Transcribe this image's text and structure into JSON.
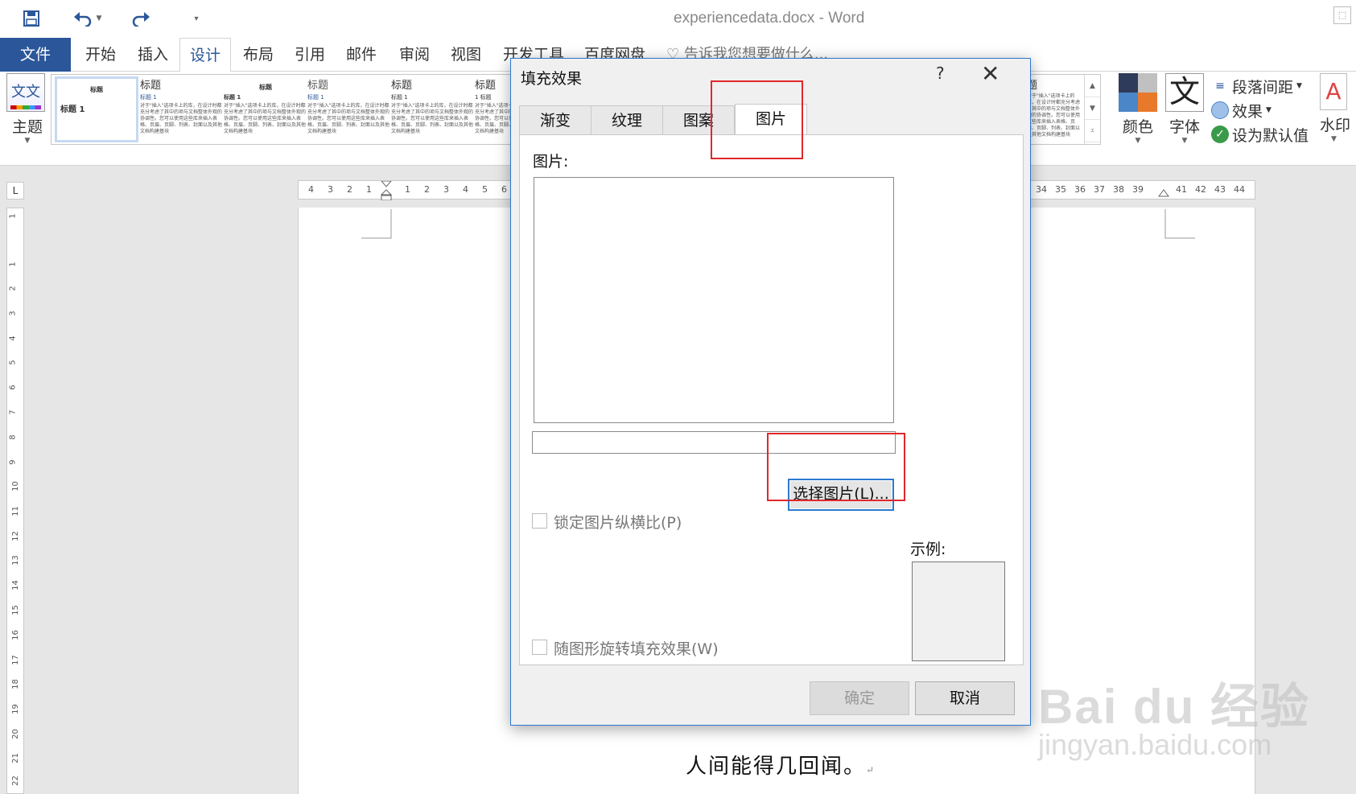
{
  "window": {
    "title": "experiencedata.docx - Word"
  },
  "qat": {
    "save_icon": "save-icon",
    "undo_icon": "undo-icon",
    "redo_icon": "redo-icon",
    "customize_icon": "customize-icon"
  },
  "tabs": [
    "文件",
    "开始",
    "插入",
    "设计",
    "布局",
    "引用",
    "邮件",
    "审阅",
    "视图",
    "开发工具",
    "百度网盘"
  ],
  "tell_me": "告诉我您想要做什么...",
  "ribbon": {
    "theme_label": "主题",
    "theme_icon_text": "文文",
    "gallery_items": [
      {
        "title": "标题",
        "sub": "标题 1",
        "style": "small"
      },
      {
        "title": "标题",
        "sub": "标题 1"
      },
      {
        "title": "标题",
        "sub": "标题 1"
      },
      {
        "title": "标题",
        "sub": "标题 1"
      },
      {
        "title": "标题",
        "sub": "标题 1"
      },
      {
        "title": "标题",
        "sub": "1 标题"
      },
      {
        "title": "题",
        "sub": ""
      }
    ],
    "gallery_body_text": "对于\"插入\"选项卡上的库，在设计时都充分考虑了其中的项与文档整体外观的协调性。您可以使用这些库来插入表格、页眉、页脚、列表、封面以及其他文档构建基块",
    "colors_label": "颜色",
    "fonts_label": "字体",
    "fonts_icon_text": "文",
    "paragraph_spacing": "段落间距",
    "effects": "效果",
    "set_default": "设为默认值",
    "watermark_label": "水印"
  },
  "ruler": {
    "h_left": [
      "4",
      "3",
      "2",
      "1",
      "1",
      "2",
      "3",
      "4",
      "5",
      "6"
    ],
    "h_right": [
      "34",
      "35",
      "36",
      "37",
      "38",
      "39",
      "41",
      "42",
      "43",
      "44"
    ],
    "v": [
      "1",
      "1",
      "2",
      "3",
      "4",
      "5",
      "6",
      "7",
      "8",
      "9",
      "10",
      "11",
      "12",
      "13",
      "14",
      "15",
      "16",
      "17",
      "18",
      "19",
      "20",
      "21",
      "22"
    ]
  },
  "document": {
    "text": "人间能得几回闻。"
  },
  "dialog": {
    "title": "填充效果",
    "help": "?",
    "close": "✕",
    "tabs": [
      "渐变",
      "纹理",
      "图案",
      "图片"
    ],
    "active_tab": "图片",
    "picture_label": "图片:",
    "path_value": "",
    "select_button": "选择图片(L)...",
    "lock_aspect": "锁定图片纵横比(P)",
    "rotate_with_shape": "随图形旋转填充效果(W)",
    "sample_label": "示例:",
    "ok": "确定",
    "cancel": "取消"
  },
  "watermark": {
    "logo": "Bai du 经验",
    "url": "jingyan.baidu.com"
  },
  "colors": {
    "accent": "#2b579a",
    "annotation": "#e0282c"
  }
}
